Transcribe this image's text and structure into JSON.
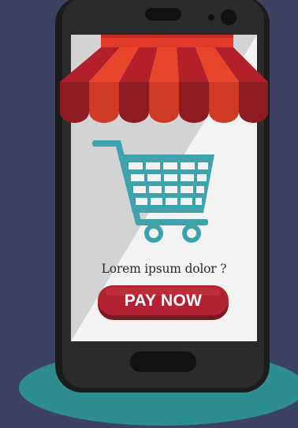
{
  "screen": {
    "prompt_text": "Lorem ipsum dolor ?",
    "pay_button_label": "PAY NOW"
  },
  "colors": {
    "background": "#3c4260",
    "floor_ellipse": "#2e8d8e",
    "phone_body": "#1d1c1c",
    "screen_light": "#f3f3f3",
    "screen_shade": "#d3d3d3",
    "cart": "#3ea3ad",
    "awning_red": "#b3202a",
    "awning_orange": "#e8442a",
    "awning_dark": "#8c1c22",
    "button_red": "#b22233",
    "button_shadow": "#7d1624"
  },
  "icons": [
    "shopping-cart-icon",
    "awning-icon",
    "camera-icon",
    "speaker-icon"
  ]
}
